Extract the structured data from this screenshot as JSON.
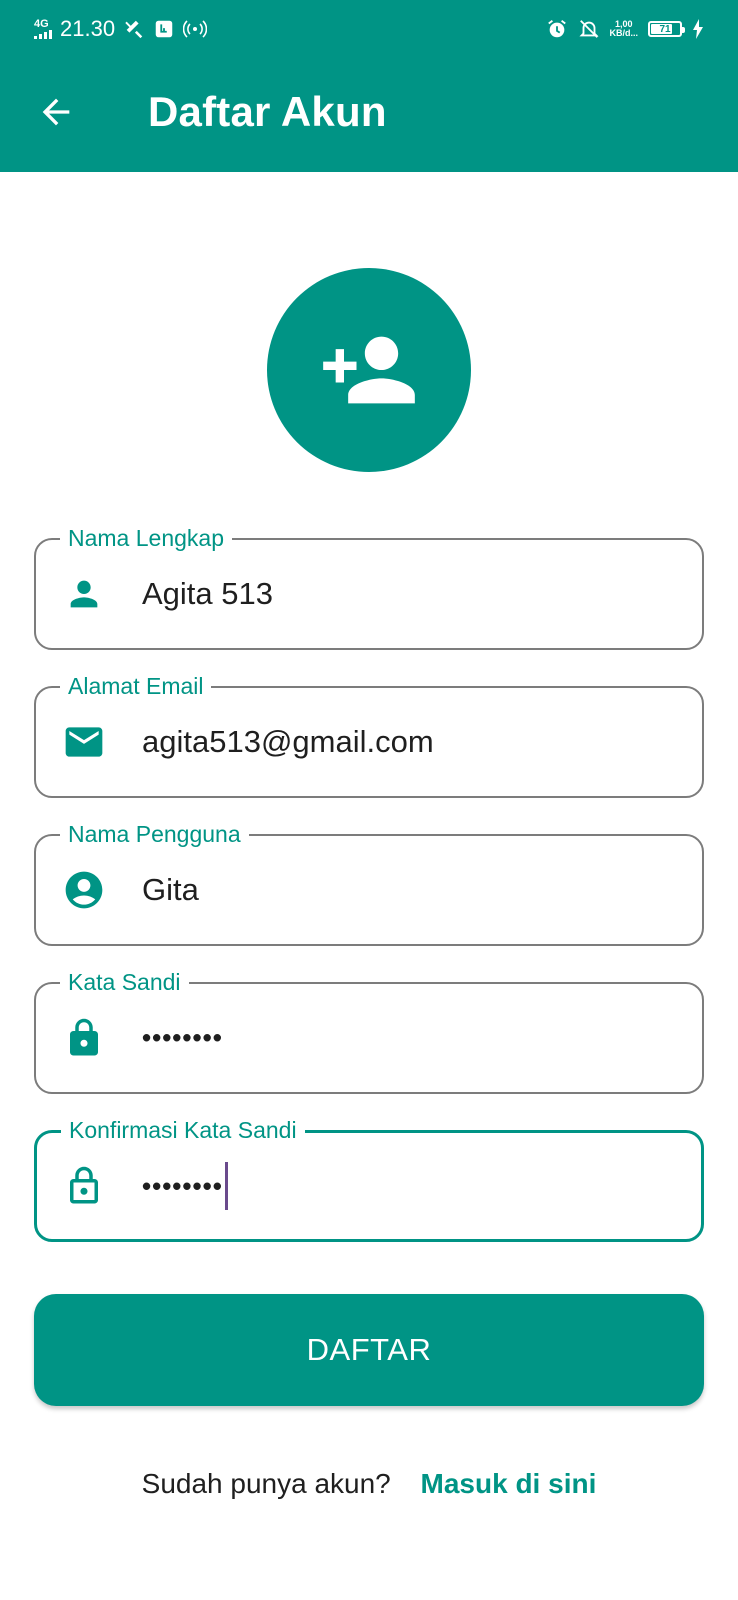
{
  "status_bar": {
    "network_type": "4G",
    "time": "21.30",
    "speed_value": "1,00",
    "speed_unit": "KB/d...",
    "battery_level": "71"
  },
  "header": {
    "title": "Daftar Akun",
    "back_icon": "arrow-back-icon"
  },
  "avatar": {
    "icon": "person-add-icon"
  },
  "form": {
    "full_name": {
      "label": "Nama Lengkap",
      "value": "Agita 513",
      "icon": "person-icon"
    },
    "email": {
      "label": "Alamat Email",
      "value": "agita513@gmail.com",
      "icon": "mail-icon"
    },
    "username": {
      "label": "Nama Pengguna",
      "value": "Gita",
      "icon": "account-circle-icon"
    },
    "password": {
      "label": "Kata Sandi",
      "value": "••••••••",
      "icon": "lock-icon"
    },
    "confirm_password": {
      "label": "Konfirmasi Kata Sandi",
      "value": "••••••••",
      "icon": "lock-outline-icon"
    }
  },
  "submit_label": "DAFTAR",
  "footer": {
    "question": "Sudah punya akun?",
    "link": "Masuk di sini"
  },
  "colors": {
    "primary": "#009485",
    "border": "#7c7c7c",
    "caret": "#6a4a8c"
  }
}
